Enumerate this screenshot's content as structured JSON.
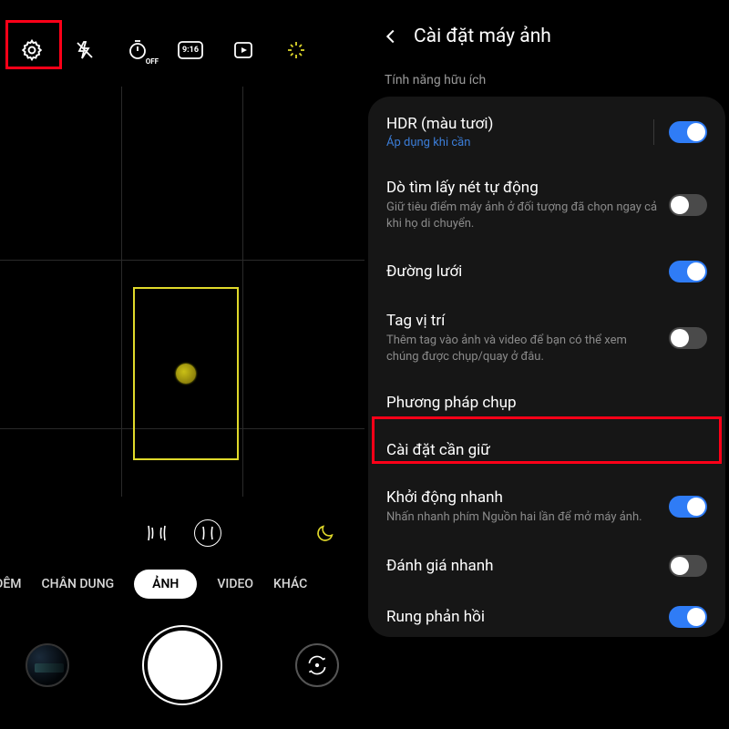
{
  "camera": {
    "toolbar": {
      "gear_icon": "settings",
      "flash_icon": "flash-off",
      "timer_icon": "timer-off",
      "ratio_icon": "ratio-9-16",
      "ratio_label": "9:16",
      "motion_icon": "motion-photo",
      "filter_icon": "filters",
      "timer_label": "OFF"
    },
    "modes": {
      "dem": "ĐÊM",
      "chandung": "CHÂN DUNG",
      "anh": "ẢNH",
      "video": "VIDEO",
      "khac": "KHÁC"
    }
  },
  "settings": {
    "title": "Cài đặt máy ảnh",
    "section": "Tính năng hữu ích",
    "rows": {
      "hdr": {
        "title": "HDR (màu tươi)",
        "sub": "Áp dụng khi cần",
        "on": true
      },
      "af": {
        "title": "Dò tìm lấy nét tự động",
        "sub": "Giữ tiêu điểm máy ảnh ở đối tượng đã chọn ngay cả khi họ di chuyển.",
        "on": false
      },
      "grid": {
        "title": "Đường lưới",
        "on": true
      },
      "loc": {
        "title": "Tag vị trí",
        "sub": "Thêm tag vào ảnh và video để bạn có thể xem chúng được chụp/quay ở đâu.",
        "on": false
      },
      "method": {
        "title": "Phương pháp chụp"
      },
      "keep": {
        "title": "Cài đặt cần giữ"
      },
      "quick": {
        "title": "Khởi động nhanh",
        "sub": "Nhấn nhanh phím Nguồn hai lần để mở máy ảnh.",
        "on": true
      },
      "review": {
        "title": "Đánh giá nhanh",
        "on": false
      },
      "haptic": {
        "title": "Rung phản hồi",
        "on": true
      }
    }
  }
}
